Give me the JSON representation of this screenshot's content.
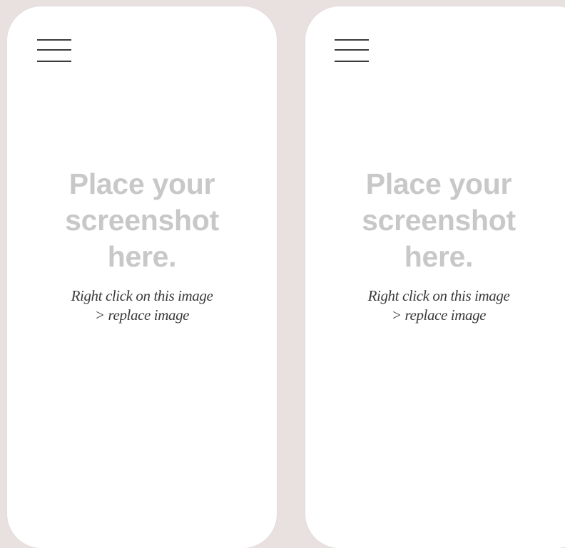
{
  "colors": {
    "background": "#e9e1e0",
    "phone_screen": "#ffffff",
    "placeholder_heading": "#c8c8c8",
    "instruction_text": "#3a3a3a",
    "menu_icon": "#3a3a3a"
  },
  "phones": [
    {
      "menu_icon": "hamburger-menu-icon",
      "placeholder": {
        "heading_lines": [
          "Place your",
          "screenshot",
          "here."
        ],
        "instruction_lines": [
          "Right click on this image",
          "> replace image"
        ]
      }
    },
    {
      "menu_icon": "hamburger-menu-icon",
      "placeholder": {
        "heading_lines": [
          "Place your",
          "screenshot",
          "here."
        ],
        "instruction_lines": [
          "Right click on this image",
          "> replace image"
        ]
      }
    }
  ]
}
